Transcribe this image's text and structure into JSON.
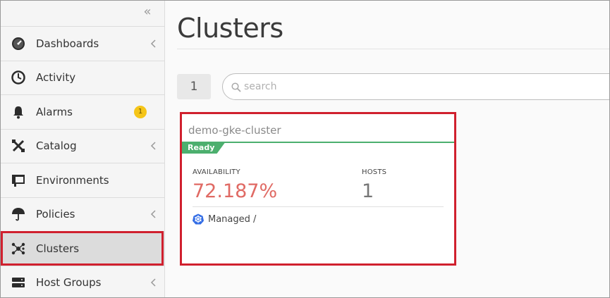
{
  "sidebar": {
    "collapse_glyph": "«",
    "items": [
      {
        "label": "Dashboards",
        "icon": "speedometer-icon",
        "has_chevron": true
      },
      {
        "label": "Activity",
        "icon": "clock-icon",
        "has_chevron": false
      },
      {
        "label": "Alarms",
        "icon": "bell-icon",
        "has_chevron": false,
        "badge": "1"
      },
      {
        "label": "Catalog",
        "icon": "tools-icon",
        "has_chevron": true
      },
      {
        "label": "Environments",
        "icon": "monitor-icon",
        "has_chevron": false
      },
      {
        "label": "Policies",
        "icon": "umbrella-icon",
        "has_chevron": true
      },
      {
        "label": "Clusters",
        "icon": "cluster-icon",
        "has_chevron": false,
        "active": true
      },
      {
        "label": "Host Groups",
        "icon": "server-icon",
        "has_chevron": true
      }
    ]
  },
  "main": {
    "title": "Clusters",
    "count": "1",
    "search": {
      "placeholder": "search",
      "value": ""
    },
    "cards": [
      {
        "name": "demo-gke-cluster",
        "status": "Ready",
        "availability_label": "AVAILABILITY",
        "availability_value": "72.187%",
        "hosts_label": "HOSTS",
        "hosts_value": "1",
        "managed_label": "Managed /"
      }
    ]
  },
  "colors": {
    "highlight": "#d0202e",
    "ready_green": "#4caf6e",
    "value_red": "#e06a64",
    "hosts_gray": "#777777",
    "badge_yellow": "#f5c518"
  }
}
